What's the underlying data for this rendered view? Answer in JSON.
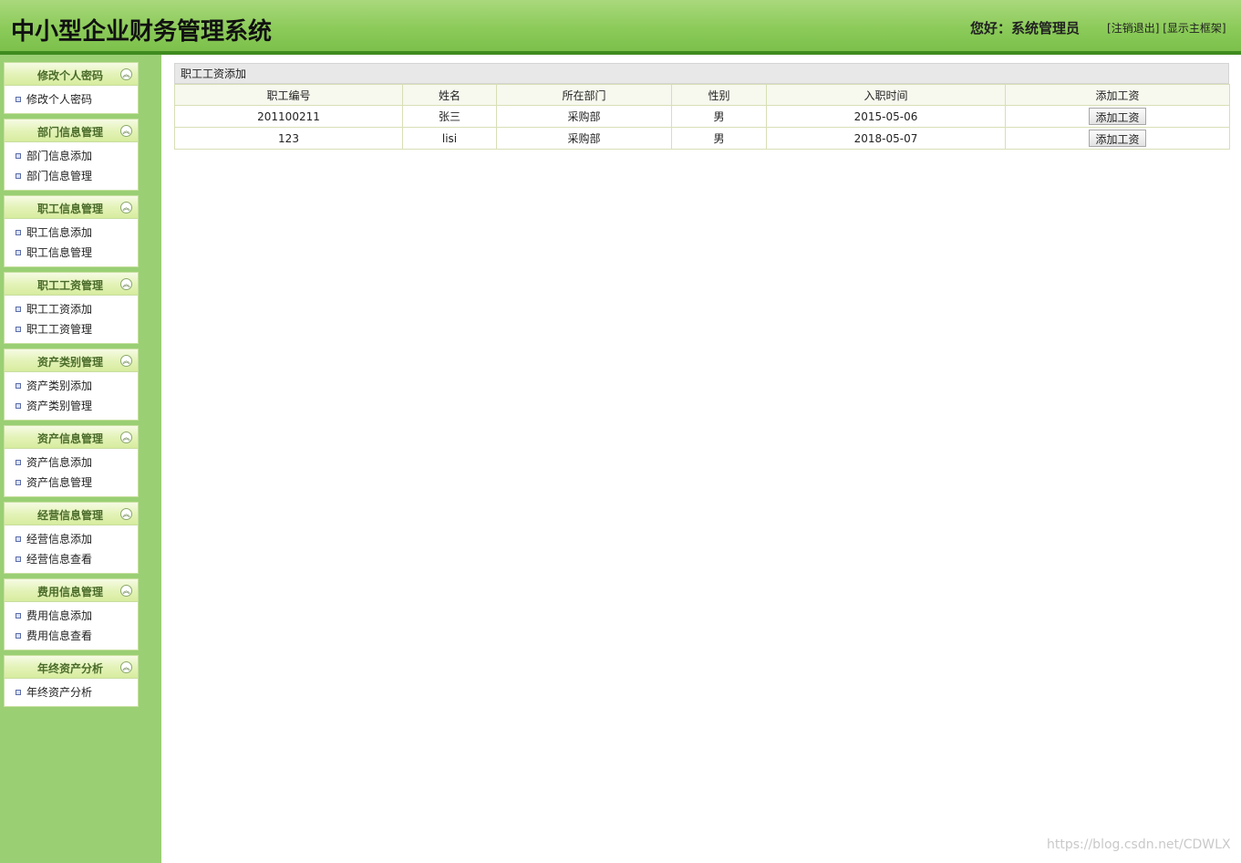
{
  "header": {
    "title": "中小型企业财务管理系统",
    "greeting": "您好：系统管理员",
    "logout_link": "注销退出",
    "show_frame_link": "显示主框架"
  },
  "sidebar": {
    "panels": [
      {
        "title": "修改个人密码",
        "items": [
          "修改个人密码"
        ]
      },
      {
        "title": "部门信息管理",
        "items": [
          "部门信息添加",
          "部门信息管理"
        ]
      },
      {
        "title": "职工信息管理",
        "items": [
          "职工信息添加",
          "职工信息管理"
        ]
      },
      {
        "title": "职工工资管理",
        "items": [
          "职工工资添加",
          "职工工资管理"
        ]
      },
      {
        "title": "资产类别管理",
        "items": [
          "资产类别添加",
          "资产类别管理"
        ]
      },
      {
        "title": "资产信息管理",
        "items": [
          "资产信息添加",
          "资产信息管理"
        ]
      },
      {
        "title": "经营信息管理",
        "items": [
          "经营信息添加",
          "经营信息查看"
        ]
      },
      {
        "title": "费用信息管理",
        "items": [
          "费用信息添加",
          "费用信息查看"
        ]
      },
      {
        "title": "年终资产分析",
        "items": [
          "年终资产分析"
        ]
      }
    ]
  },
  "main": {
    "title": "职工工资添加",
    "columns": [
      "职工编号",
      "姓名",
      "所在部门",
      "性别",
      "入职时间",
      "添加工资"
    ],
    "rows": [
      {
        "id": "201100211",
        "name": "张三",
        "dept": "采购部",
        "gender": "男",
        "hire_date": "2015-05-06",
        "action": "添加工资"
      },
      {
        "id": "123",
        "name": "lisi",
        "dept": "采购部",
        "gender": "男",
        "hire_date": "2018-05-07",
        "action": "添加工资"
      }
    ]
  },
  "watermark": "https://blog.csdn.net/CDWLX"
}
